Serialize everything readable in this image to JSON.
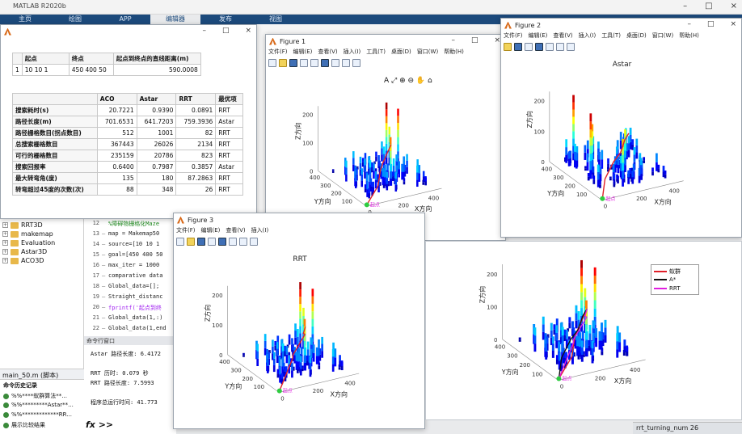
{
  "app_title": "MATLAB R2020b",
  "ribbon_tabs": [
    "主页",
    "绘图",
    "APP",
    "编辑器",
    "发布",
    "视图"
  ],
  "ribbon_active": 3,
  "folder_items": [
    "RRT3D",
    "makemap",
    "Evaluation",
    "Astar3D",
    "ACO3D"
  ],
  "script_tab": "main_50.m  (脚本)",
  "history": {
    "title": "命令历史记录",
    "items": [
      "%%****蚁群算法**...",
      "%%*********Astar**...",
      "%%*************RR...",
      "展示比较结果"
    ]
  },
  "editor_lines": [
    {
      "n": "12",
      "code": "%障碍物栅格化Maze"
    },
    {
      "n": "13",
      "code": "map = Makemap50"
    },
    {
      "n": "14",
      "code": "source=[10 10 1"
    },
    {
      "n": "15",
      "code": "goal=[450 400 50"
    },
    {
      "n": "16",
      "code": "max_iter = 1000"
    },
    {
      "n": "17",
      "code": "comparative data"
    },
    {
      "n": "18",
      "code": "Global_data=[];"
    },
    {
      "n": "19",
      "code": "Straight_distanc"
    },
    {
      "n": "20",
      "code": "fprintf('起点到终"
    },
    {
      "n": "21",
      "code": "Global_data(1,:)"
    },
    {
      "n": "22",
      "code": "Global_data(1,end"
    }
  ],
  "cmd_window": {
    "title": "命令行窗口",
    "lines": [
      "Astar 路径长度: 6.4172",
      "RRT 历时: 0.079 秒",
      "RRT 路径长度: 7.5993",
      "程序总运行时间: 41.773"
    ],
    "prompt": "fx >>"
  },
  "status_text": "rrt_turning_num    26",
  "table_window": {
    "top_headers": [
      "起点",
      "终点",
      "起点到终点的直线距离(m)"
    ],
    "top_row": {
      "idx": "1",
      "start": "10 10 1",
      "end": "450 400 50",
      "dist": "590.0008"
    },
    "headers": [
      "",
      "ACO",
      "Astar",
      "RRT",
      "最优项"
    ],
    "rows": [
      [
        "搜索耗时(s)",
        "20.7221",
        "0.9390",
        "0.0891",
        "RRT"
      ],
      [
        "路径长度(m)",
        "701.6531",
        "641.7203",
        "759.3936",
        "Astar"
      ],
      [
        "路径栅格数目(拐点数目)",
        "512",
        "1001",
        "82",
        "RRT"
      ],
      [
        "总搜索栅格数目",
        "367443",
        "26026",
        "2134",
        "RRT"
      ],
      [
        "可行的栅格数目",
        "235159",
        "20786",
        "823",
        "RRT"
      ],
      [
        "搜索回报率",
        "0.6400",
        "0.7987",
        "0.3857",
        "Astar"
      ],
      [
        "最大转弯角(度)",
        "135",
        "180",
        "87.2863",
        "RRT"
      ],
      [
        "转弯超过45度的次数(次)",
        "88",
        "348",
        "26",
        "RRT"
      ]
    ]
  },
  "menu": [
    "文件(F)",
    "编辑(E)",
    "查看(V)",
    "插入(I)",
    "工具(T)",
    "桌面(D)",
    "窗口(W)",
    "帮助(H)"
  ],
  "menu_short": [
    "文件(F)",
    "编辑(E)",
    "查看(V)",
    "插入(I)"
  ],
  "figure1": {
    "title": "Figure 1",
    "toolbar_label": "A"
  },
  "figure2": {
    "title": "Figure 2",
    "axes_title": "Astar"
  },
  "figure3": {
    "title": "Figure 3",
    "axes_title": "RRT"
  },
  "axes_labels": {
    "x": "X方向",
    "y": "Y方向",
    "z": "Z方向",
    "start_marker": "起点"
  },
  "legend": [
    "蚁群",
    "A*",
    "RRT"
  ],
  "colors": {
    "aco": "#e0202a",
    "astar": "#111111",
    "rrt": "#e01ee0"
  }
}
